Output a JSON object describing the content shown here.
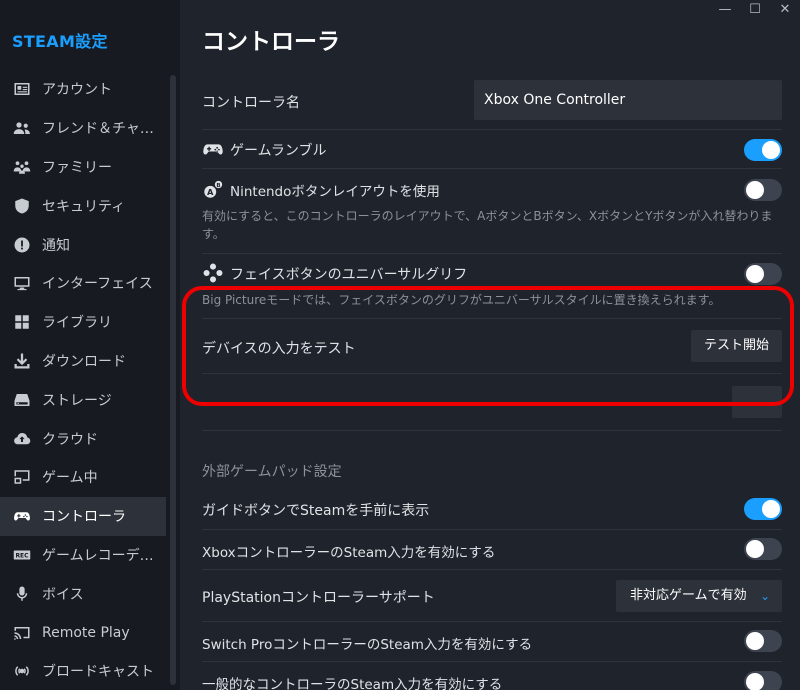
{
  "sidebar": {
    "title": "STEAM設定",
    "items": [
      {
        "label": "アカウント",
        "icon": "account-card-icon",
        "active": false
      },
      {
        "label": "フレンド＆チャ…",
        "icon": "friends-icon",
        "active": false
      },
      {
        "label": "ファミリー",
        "icon": "family-icon",
        "active": false
      },
      {
        "label": "セキュリティ",
        "icon": "shield-icon",
        "active": false
      },
      {
        "label": "通知",
        "icon": "alert-icon",
        "active": false
      },
      {
        "label": "インターフェイス",
        "icon": "monitor-icon",
        "active": false
      },
      {
        "label": "ライブラリ",
        "icon": "grid-icon",
        "active": false
      },
      {
        "label": "ダウンロード",
        "icon": "download-icon",
        "active": false
      },
      {
        "label": "ストレージ",
        "icon": "storage-icon",
        "active": false
      },
      {
        "label": "クラウド",
        "icon": "cloud-icon",
        "active": false
      },
      {
        "label": "ゲーム中",
        "icon": "in-game-icon",
        "active": false
      },
      {
        "label": "コントローラ",
        "icon": "controller-icon",
        "active": true
      },
      {
        "label": "ゲームレコーデ…",
        "icon": "rec-icon",
        "active": false
      },
      {
        "label": "ボイス",
        "icon": "microphone-icon",
        "active": false
      },
      {
        "label": "Remote Play",
        "icon": "remote-play-icon",
        "active": false
      },
      {
        "label": "ブロードキャスト",
        "icon": "broadcast-icon",
        "active": false
      }
    ]
  },
  "window": {
    "minimize": "—",
    "maximize": "☐",
    "close": "✕"
  },
  "main": {
    "title": "コントローラ",
    "controller_name_label": "コントローラ名",
    "controller_name_value": "Xbox One Controller",
    "game_rumble_label": "ゲームランブル",
    "game_rumble_on": true,
    "nintendo_layout_label": "Nintendoボタンレイアウトを使用",
    "nintendo_layout_on": false,
    "nintendo_layout_desc": "有効にすると、このコントローラのレイアウトで、AボタンとBボタン、XボタンとYボタンが入れ替わります。",
    "universal_glyph_label": "フェイスボタンのユニバーサルグリフ",
    "universal_glyph_on": false,
    "universal_glyph_desc": "Big Pictureモードでは、フェイスボタンのグリフがユニバーサルスタイルに置き換えられます。",
    "test_input_label": "デバイスの入力をテスト",
    "test_input_button": "テスト開始",
    "external_section": "外部ゲームパッド設定",
    "guide_button_label": "ガイドボタンでSteamを手前に表示",
    "guide_button_on": true,
    "xbox_input_label": "XboxコントローラーのSteam入力を有効にする",
    "xbox_input_on": false,
    "ps_support_label": "PlayStationコントローラーサポート",
    "ps_support_value": "非対応ゲームで有効",
    "switch_pro_label": "Switch ProコントローラーのSteam入力を有効にする",
    "switch_pro_on": false,
    "generic_label": "一般的なコントローラのSteam入力を有効にする",
    "generic_on": false
  },
  "colors": {
    "accent": "#1a9fff",
    "highlight": "#ee0000"
  }
}
